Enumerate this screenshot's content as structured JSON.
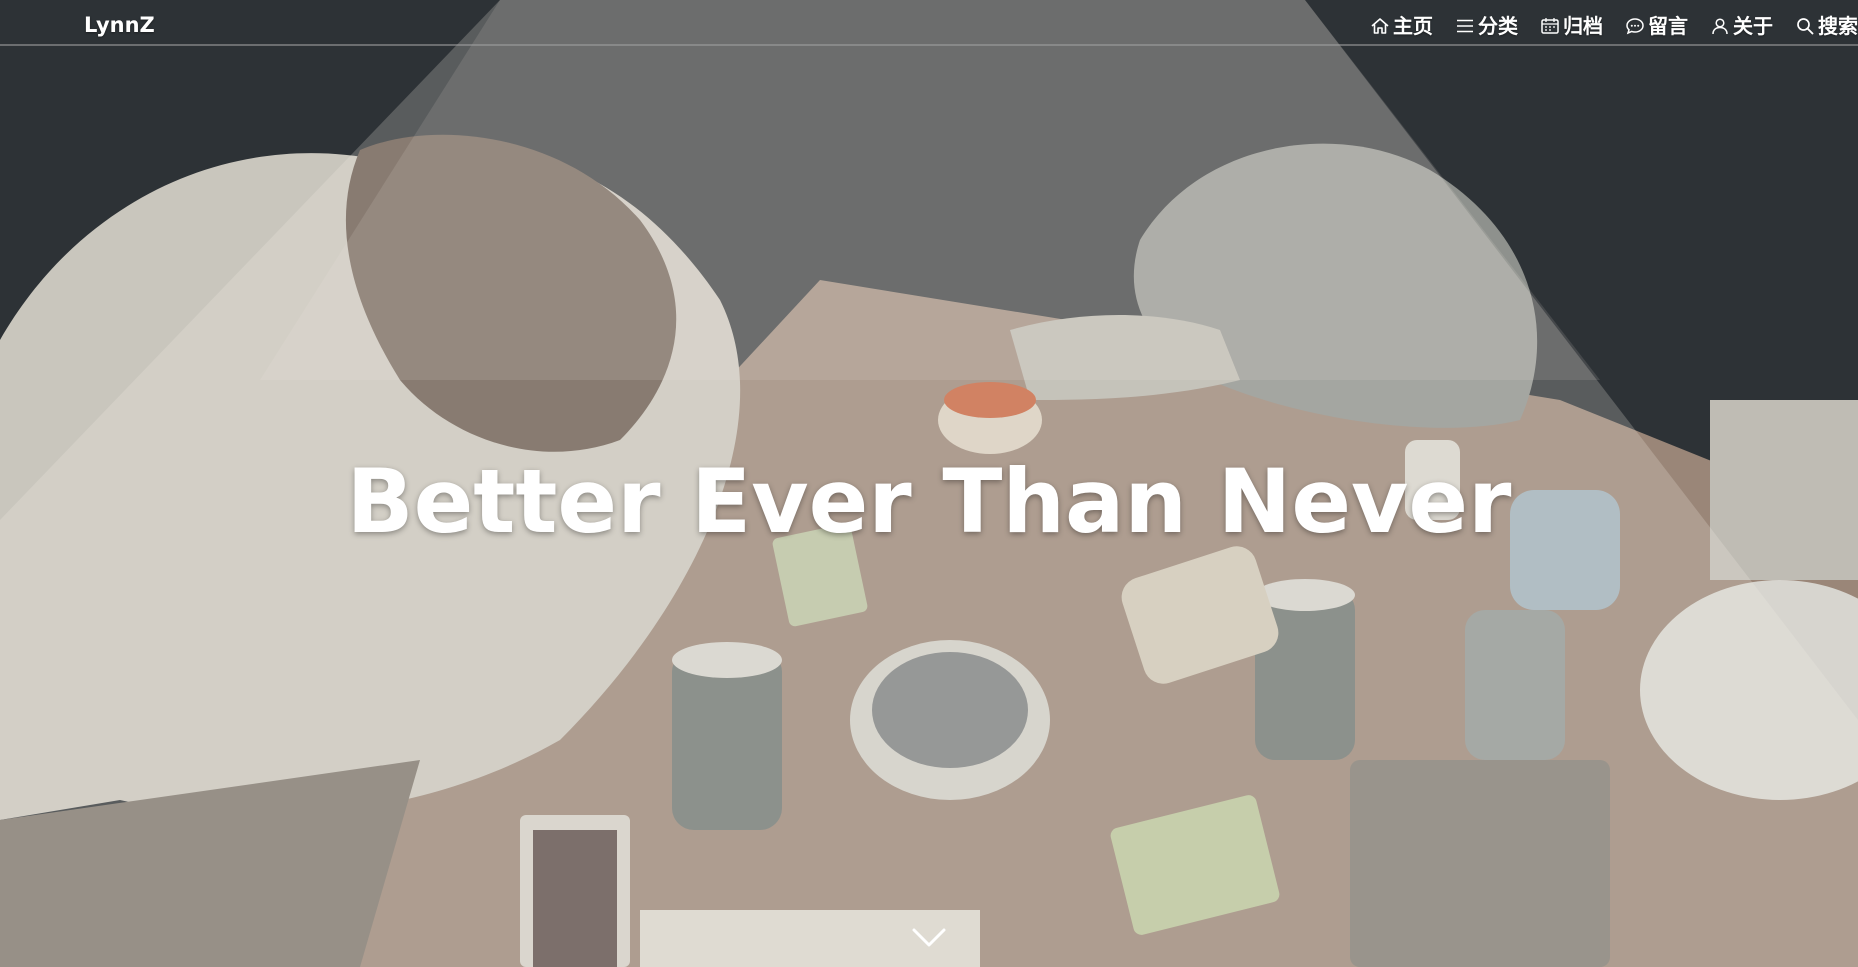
{
  "site": {
    "brand": "LynnZ"
  },
  "nav": {
    "items": [
      {
        "label": "主页",
        "icon": "home-icon"
      },
      {
        "label": "分类",
        "icon": "list-icon"
      },
      {
        "label": "归档",
        "icon": "calendar-icon"
      },
      {
        "label": "留言",
        "icon": "chat-bubble-icon"
      },
      {
        "label": "关于",
        "icon": "user-icon"
      },
      {
        "label": "搜索",
        "icon": "search-icon"
      }
    ]
  },
  "hero": {
    "title": "Better Ever Than Never",
    "background": "illustration-tired-people-at-table-under-lamp",
    "scroll_icon": "chevron-down-icon"
  },
  "colors": {
    "nav_text": "#ffffff",
    "title_text": "#ffffff",
    "dark_bg": "#2c3034",
    "table": "#9b8a7c",
    "light_cone": "#8a8a86"
  }
}
